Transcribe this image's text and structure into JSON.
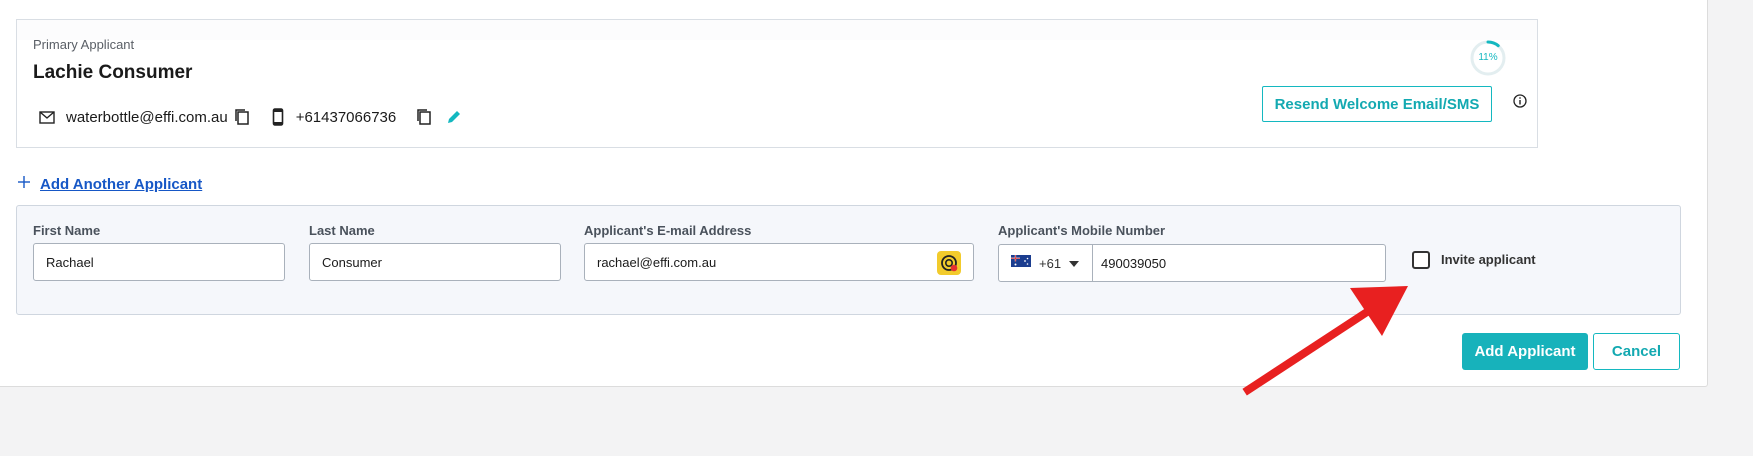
{
  "primary_applicant": {
    "section_label": "Primary Applicant",
    "name": "Lachie Consumer",
    "email": "waterbottle@effi.com.au",
    "phone": "+61437066736",
    "progress_label": "11%",
    "progress_value": 0.11,
    "resend_label": "Resend Welcome Email/SMS"
  },
  "add_another": {
    "label": "Add Another Applicant"
  },
  "form": {
    "first_name": {
      "label": "First Name",
      "value": "Rachael"
    },
    "last_name": {
      "label": "Last Name",
      "value": "Consumer"
    },
    "email": {
      "label": "Applicant's E-mail Address",
      "value": "rachael@effi.com.au"
    },
    "mobile": {
      "label": "Applicant's Mobile Number",
      "country_code": "+61",
      "value": "490039050"
    },
    "invite_label": "Invite applicant",
    "invite_checked": false
  },
  "actions": {
    "add_label": "Add Applicant",
    "cancel_label": "Cancel"
  },
  "colors": {
    "accent": "#17b2bb",
    "link": "#1657c6",
    "annotation_arrow": "#e82020"
  },
  "icons": [
    "mail-icon",
    "copy-icon",
    "phone-icon",
    "edit-icon",
    "info-icon",
    "plus-icon",
    "chevron-down-icon",
    "au-flag-icon",
    "password-manager-icon"
  ]
}
